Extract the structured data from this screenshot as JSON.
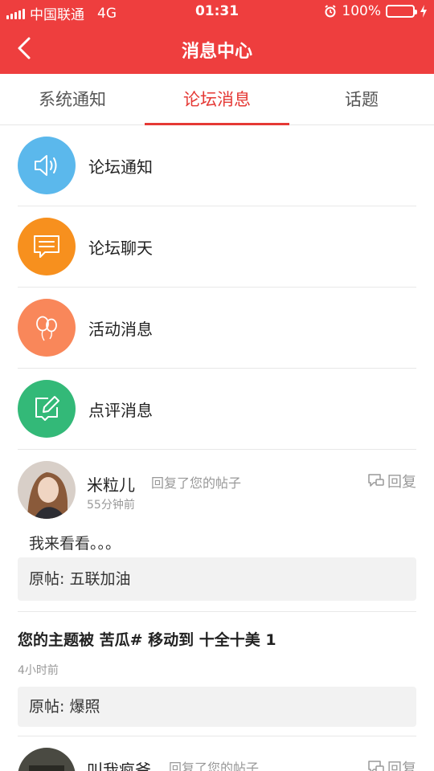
{
  "status_bar": {
    "carrier": "中国联通",
    "network": "4G",
    "time": "01:31",
    "battery": "100%"
  },
  "header": {
    "title": "消息中心"
  },
  "tabs": [
    {
      "label": "系统通知",
      "active": false
    },
    {
      "label": "论坛消息",
      "active": true
    },
    {
      "label": "话题",
      "active": false
    }
  ],
  "categories": [
    {
      "label": "论坛通知",
      "icon": "speaker-icon",
      "color": "#5bb8ec"
    },
    {
      "label": "论坛聊天",
      "icon": "chat-icon",
      "color": "#f7901e"
    },
    {
      "label": "活动消息",
      "icon": "balloon-icon",
      "color": "#f9875a"
    },
    {
      "label": "点评消息",
      "icon": "edit-icon",
      "color": "#33b978"
    }
  ],
  "messages": [
    {
      "username": "米粒儿",
      "action": "回复了您的帖子",
      "time": "55分钟前",
      "reply_label": "回复",
      "content": "我来看看。。。",
      "original": "原帖: 五联加油"
    },
    {
      "title": "您的主题被 苦瓜# 移动到 十全十美 1",
      "time": "4小时前",
      "original": "原帖: 爆照"
    },
    {
      "username": "叫我疯爷",
      "action": "回复了您的帖子",
      "reply_label": "回复"
    }
  ]
}
